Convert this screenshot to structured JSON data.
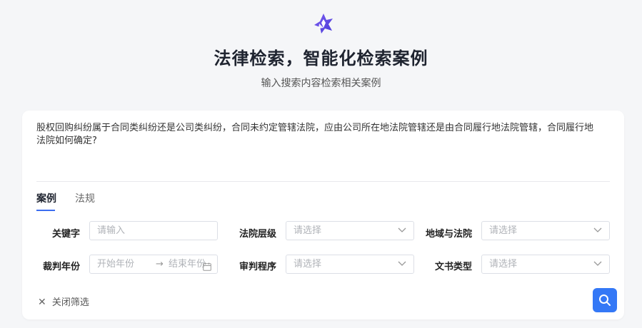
{
  "header": {
    "logo_icon": "star-logo-icon",
    "title": "法律检索，智能化检索案例",
    "subtitle": "输入搜索内容检索相关案例"
  },
  "query": {
    "text": "股权回购纠纷属于合同类纠纷还是公司类纠纷，合同未约定管辖法院，应由公司所在地法院管辖还是由合同履行地法院管辖，合同履行地法院如何确定?"
  },
  "tabs": [
    {
      "label": "案例",
      "active": true
    },
    {
      "label": "法规",
      "active": false
    }
  ],
  "filters": {
    "keyword": {
      "label": "关键字",
      "placeholder": "请输入"
    },
    "court_level": {
      "label": "法院层级",
      "placeholder": "请选择"
    },
    "region_court": {
      "label": "地域与法院",
      "placeholder": "请选择"
    },
    "judgment_year": {
      "label": "裁判年份",
      "start_placeholder": "开始年份",
      "separator": "→",
      "end_placeholder": "结束年份"
    },
    "procedure": {
      "label": "审判程序",
      "placeholder": "请选择"
    },
    "doc_type": {
      "label": "文书类型",
      "placeholder": "请选择"
    }
  },
  "actions": {
    "close_filter_label": "关闭筛选",
    "search_icon": "search-icon"
  },
  "colors": {
    "accent": "#3478f6",
    "logo": "#6b4ee6"
  }
}
